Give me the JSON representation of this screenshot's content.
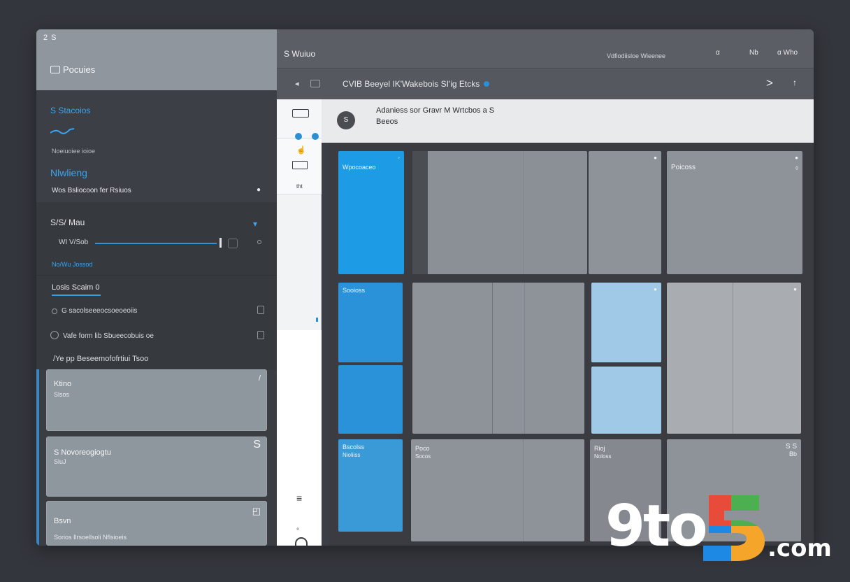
{
  "window": {
    "corner_label": "2 S"
  },
  "sidebar": {
    "title": "Pocuies",
    "section1": {
      "heading": "S Stacoios",
      "small_text": "Noeiuoiee ioioe",
      "heading2": "Nlwlieng",
      "line": "Wos Bsliocoon fer Rsiuos"
    },
    "section2": {
      "title": "S/S/ Mau",
      "slider_label": "WI V/Sob",
      "blue_label": "No/Wu Jossod",
      "row2_title": "Losis Scaim 0",
      "items": [
        "G sacolseeeocsoeoeoiis",
        "Vafe form lib Sbueecobuis oe",
        "/Ye pp Beseemofofrtiui Tsoo"
      ]
    },
    "cards": [
      {
        "title": "Ktino",
        "sub": "Slsos",
        "icon": "/"
      },
      {
        "title": "S Novoreogiogtu",
        "sub": "SluJ",
        "icon": "S"
      },
      {
        "title": "Bsvn",
        "sub": "Sorios Ilrsoellsoli Nflsioeis",
        "icon": "◰"
      }
    ]
  },
  "topbar": {
    "app_title": "S Wuiuo",
    "center_text": "Vdfiodiisloe Wieenee",
    "icons": [
      "α",
      "Nb",
      "α Who"
    ]
  },
  "toolbar": {
    "path": "CVIB Beeyel IK'Wakebois SI'ig Etcks",
    "chevron": ">",
    "up": "↑"
  },
  "infobar": {
    "avatar_glyph": "S",
    "line1": "Adaniess  sor  Gravr  M Wrtcbos  a S",
    "line2": "Beeos"
  },
  "rail": {
    "num_label": "tht"
  },
  "tiles": {
    "t1": "Wpocoaceo",
    "t2": "Sooioss",
    "t3": "Bscolss",
    "t3b": "Nioliiss",
    "t4": "Poicoss",
    "t5": "Poco",
    "t5b": "Socos",
    "t6": "Rioj",
    "t6b": "Noloss",
    "t7": "S S",
    "t7b": "Bb"
  },
  "watermark": {
    "left": "9to",
    "digit": "5",
    "suffix": ".com"
  }
}
